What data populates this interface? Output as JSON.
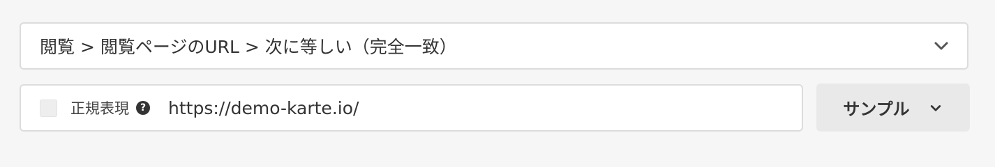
{
  "condition_select": {
    "value": "閲覧 > 閲覧ページのURL > 次に等しい（完全一致）",
    "icon": "chevron-down-icon"
  },
  "value_row": {
    "regex_checkbox_checked": false,
    "regex_label": "正規表現",
    "help_icon": "question-circle-icon",
    "help_glyph": "?",
    "url_value": "https://demo-karte.io/",
    "url_placeholder": ""
  },
  "sample_button": {
    "label": "サンプル",
    "icon": "chevron-down-icon"
  },
  "colors": {
    "page_background": "#f6f6f6",
    "border": "#dcdcdc",
    "text": "#333333",
    "button_background": "#e9e9e9"
  }
}
